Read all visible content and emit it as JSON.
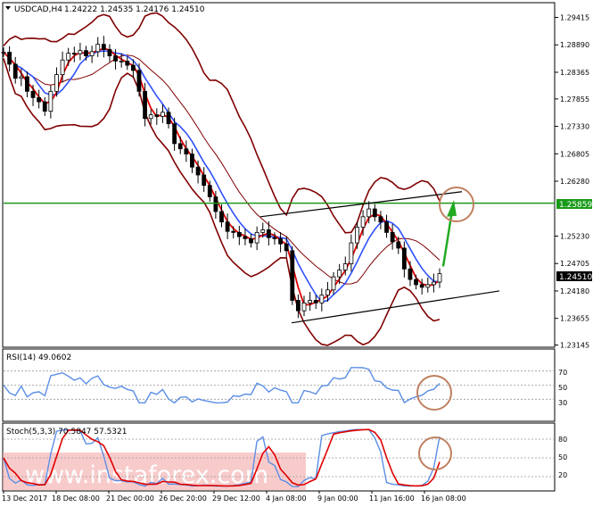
{
  "header": {
    "symbol": "USDCAD,H4",
    "ohlc": "1.24222 1.24535 1.24176 1.24510"
  },
  "colors": {
    "price": "#c00000",
    "band": "#800000",
    "ma_fast": "#e00000",
    "ma_slow": "#3050ff",
    "support_resistance": "#1a9a1a",
    "channel": "#000000",
    "target_arrow": "#22aa22",
    "circle": "#c08060",
    "rsi": "#5b8ee6",
    "stoch_main": "#5b8ee6",
    "stoch_signal": "#e00000",
    "watermark_band": "#f2a0a0"
  },
  "price_labels": {
    "level": "1.25859",
    "current": "1.24510"
  },
  "rsi": {
    "label": "RSI(14) 49.0602",
    "levels": [
      "70",
      "50",
      "30"
    ]
  },
  "stoch": {
    "label": "Stoch(5,3,3) 70.5847 57.5321",
    "levels": [
      "80",
      "50",
      "20"
    ]
  },
  "x_labels": [
    "13 Dec 2017",
    "18 Dec 08:00",
    "21 Dec 00:00",
    "26 Dec 20:00",
    "29 Dec 12:00",
    "4 Jan 08:00",
    "9 Jan 00:00",
    "11 Jan 16:00",
    "16 Jan 08:00"
  ],
  "watermark": "www.instaforex.com",
  "chart_data": {
    "type": "line",
    "symbol": "USDCAD",
    "timeframe": "H4",
    "y_ticks": [
      "1.29415",
      "1.28890",
      "1.28365",
      "1.27855",
      "1.27330",
      "1.26805",
      "1.26280",
      "1.25230",
      "1.24705",
      "1.24180",
      "1.23655",
      "1.23145"
    ],
    "ylim": [
      1.2312,
      1.2968
    ],
    "horizontal_level": 1.25859,
    "current_price": 1.2451,
    "series": [
      {
        "name": "",
        "values": [
          1.2875,
          1.2852,
          1.2825,
          1.2828,
          1.28,
          1.2788,
          1.278,
          1.2762,
          1.28,
          1.2832,
          1.286,
          1.2873,
          1.2872,
          1.2878,
          1.2868,
          1.2876,
          1.289,
          1.288,
          1.2868,
          1.2858,
          1.2858,
          1.285,
          1.284,
          1.28,
          1.2748,
          1.2755,
          1.2752,
          1.276,
          1.2738,
          1.27,
          1.269,
          1.268,
          1.2655,
          1.264,
          1.262,
          1.2598,
          1.257,
          1.255,
          1.2532,
          1.253,
          1.2522,
          1.2518,
          1.251,
          1.253,
          1.2535,
          1.252,
          1.2518,
          1.2508,
          1.2495,
          1.24,
          1.238,
          1.2395,
          1.24,
          1.2395,
          1.241,
          1.242,
          1.2445,
          1.2458,
          1.247,
          1.251,
          1.254,
          1.256,
          1.2575,
          1.256,
          1.255,
          1.253,
          1.2512,
          1.25,
          1.246,
          1.244,
          1.243,
          1.2425,
          1.243,
          1.2435,
          1.2451
        ]
      }
    ]
  }
}
